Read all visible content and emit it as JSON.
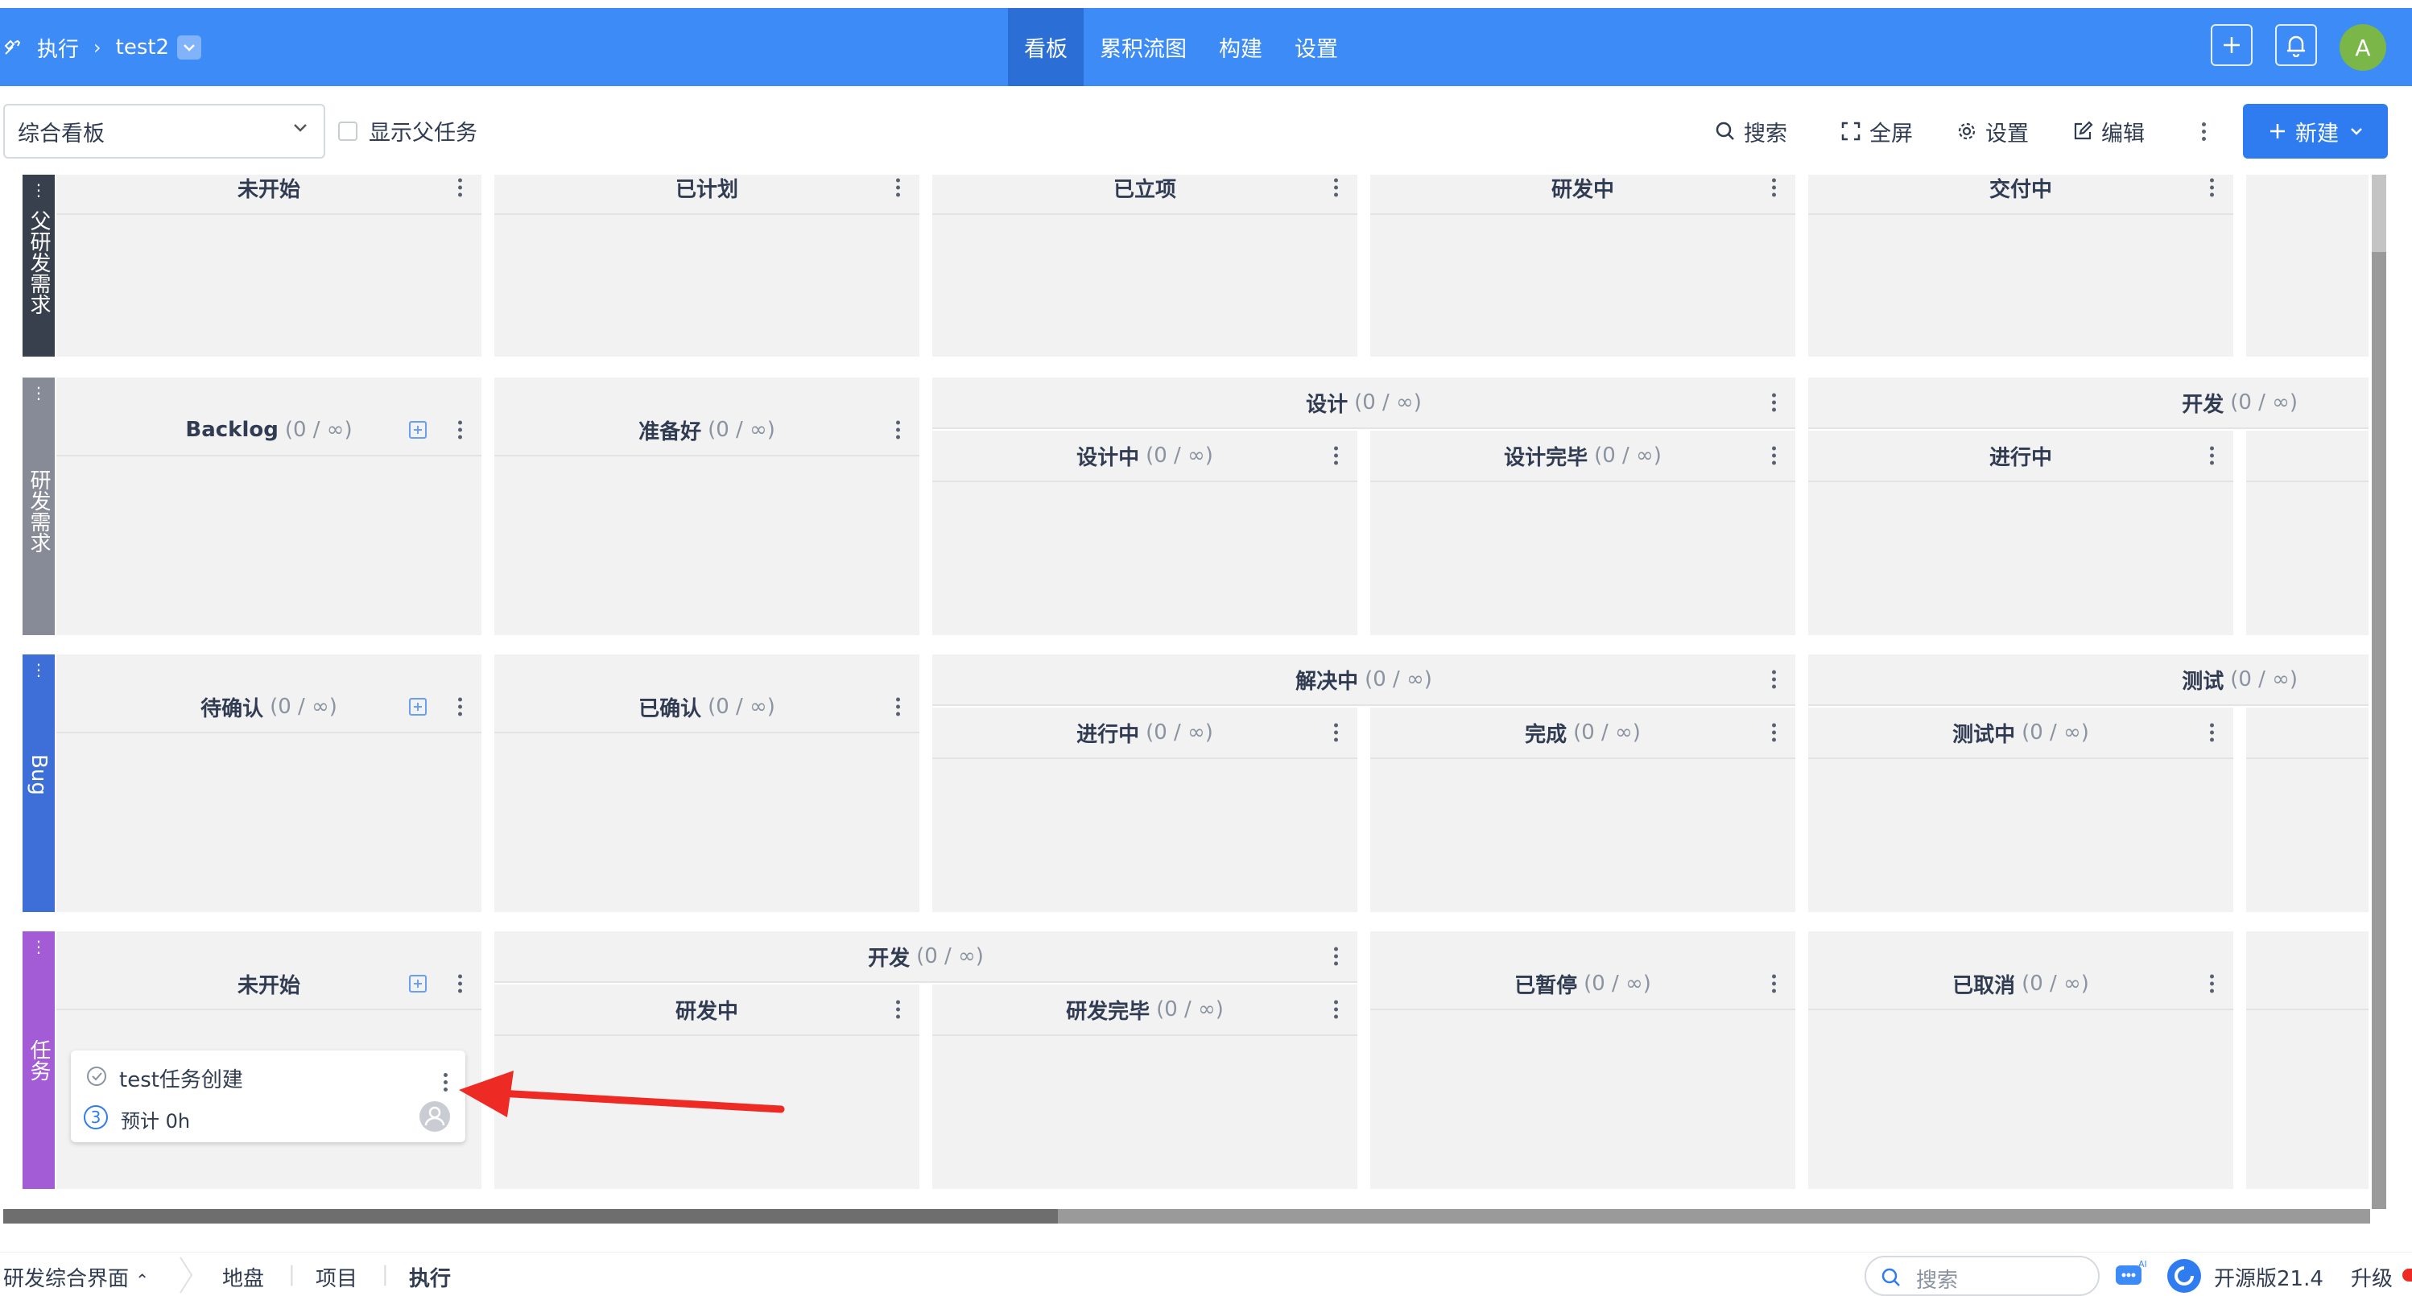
{
  "header": {
    "breadcrumb_root": "执行",
    "breadcrumb_current": "test2",
    "tabs": [
      "看板",
      "累积流图",
      "构建",
      "设置"
    ],
    "active_tab": "看板",
    "avatar_letter": "A"
  },
  "toolbar": {
    "board_select": "综合看板",
    "show_parent_label": "显示父任务",
    "search": "搜索",
    "fullscreen": "全屏",
    "settings": "设置",
    "edit": "编辑",
    "new": "新建"
  },
  "lanes": [
    {
      "label": "父研发需求",
      "color": "#39404d",
      "columns": [
        {
          "title": "未开始",
          "count": ""
        },
        {
          "title": "已计划",
          "count": ""
        },
        {
          "title": "已立项",
          "count": ""
        },
        {
          "title": "研发中",
          "count": ""
        },
        {
          "title": "交付中",
          "count": ""
        }
      ]
    },
    {
      "label": "研发需求",
      "color": "#878b98",
      "columns": [
        {
          "title": "Backlog",
          "count": "(0 / ∞)"
        },
        {
          "title": "准备好",
          "count": "(0 / ∞)"
        },
        {
          "group": "设计",
          "group_count": "(0 / ∞)",
          "title": "设计中",
          "count": "(0 / ∞)"
        },
        {
          "title": "设计完毕",
          "count": "(0 / ∞)"
        },
        {
          "group": "开发",
          "group_count": "(0 / ∞)",
          "title": "进行中",
          "count": ""
        }
      ]
    },
    {
      "label": "Bug",
      "color": "#3e6fd8",
      "columns": [
        {
          "title": "待确认",
          "count": "(0 / ∞)"
        },
        {
          "title": "已确认",
          "count": "(0 / ∞)"
        },
        {
          "group": "解决中",
          "group_count": "(0 / ∞)",
          "title": "进行中",
          "count": "(0 / ∞)"
        },
        {
          "title": "完成",
          "count": "(0 / ∞)"
        },
        {
          "group": "测试",
          "group_count": "(0 / ∞)",
          "title": "测试中",
          "count": "(0 / ∞)"
        }
      ]
    },
    {
      "label": "任务",
      "color": "#a35cd6",
      "columns": [
        {
          "title": "未开始",
          "count": ""
        },
        {
          "group": "开发",
          "group_count": "(0 / ∞)",
          "title": "研发中",
          "count": ""
        },
        {
          "title": "研发完毕",
          "count": "(0 / ∞)"
        },
        {
          "title": "已暂停",
          "count": "(0 / ∞)"
        },
        {
          "title": "已取消",
          "count": "(0 / ∞)"
        }
      ]
    }
  ],
  "card": {
    "title": "test任务创建",
    "priority": "3",
    "estimate": "预计 0h"
  },
  "bottom": {
    "menu": "研发综合界面",
    "crumbs": [
      "地盘",
      "项目",
      "执行"
    ],
    "search_placeholder": "搜索",
    "version": "开源版21.4",
    "upgrade": "升级"
  }
}
